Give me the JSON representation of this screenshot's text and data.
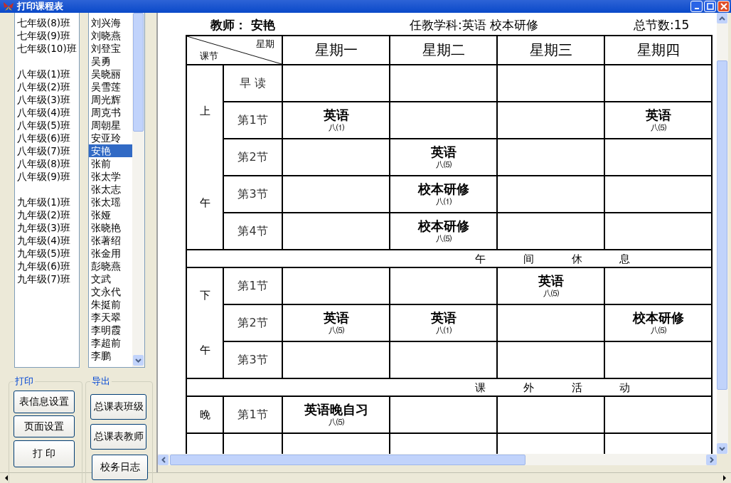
{
  "window": {
    "title": "打印课程表"
  },
  "class_groups": [
    [
      "七年级(8)班",
      "七年级(9)班",
      "七年级(10)班"
    ],
    [
      "八年级(1)班",
      "八年级(2)班",
      "八年级(3)班",
      "八年级(4)班",
      "八年级(5)班",
      "八年级(6)班",
      "八年级(7)班",
      "八年级(8)班",
      "八年级(9)班"
    ],
    [
      "九年级(1)班",
      "九年级(2)班",
      "九年级(3)班",
      "九年级(4)班",
      "九年级(5)班",
      "九年级(6)班",
      "九年级(7)班"
    ]
  ],
  "teachers": [
    {
      "name": "刘兴海",
      "selected": false
    },
    {
      "name": "刘晓燕",
      "selected": false
    },
    {
      "name": "刘登宝",
      "selected": false
    },
    {
      "name": "吴勇",
      "selected": false
    },
    {
      "name": "吴晓丽",
      "selected": false
    },
    {
      "name": "吴雪莲",
      "selected": false
    },
    {
      "name": "周光辉",
      "selected": false
    },
    {
      "name": "周克书",
      "selected": false
    },
    {
      "name": "周朝星",
      "selected": false
    },
    {
      "name": "安亚玲",
      "selected": false
    },
    {
      "name": "安艳",
      "selected": true
    },
    {
      "name": "张前",
      "selected": false
    },
    {
      "name": "张太学",
      "selected": false
    },
    {
      "name": "张太志",
      "selected": false
    },
    {
      "name": "张太瑶",
      "selected": false
    },
    {
      "name": "张娅",
      "selected": false
    },
    {
      "name": "张晓艳",
      "selected": false
    },
    {
      "name": "张著绍",
      "selected": false
    },
    {
      "name": "张金用",
      "selected": false
    },
    {
      "name": "彭晓燕",
      "selected": false
    },
    {
      "name": "文武",
      "selected": false
    },
    {
      "name": "文永代",
      "selected": false
    },
    {
      "name": "朱挺前",
      "selected": false
    },
    {
      "name": "李天翠",
      "selected": false
    },
    {
      "name": "李明霞",
      "selected": false
    },
    {
      "name": "李超前",
      "selected": false
    },
    {
      "name": "李鹏",
      "selected": false
    }
  ],
  "print_group": {
    "title": "打印",
    "buttons": [
      "表信息设置",
      "页面设置",
      "打 印"
    ]
  },
  "export_group": {
    "title": "导出",
    "buttons": [
      "总课表班级",
      "总课表教师",
      "校务日志"
    ]
  },
  "header": {
    "teacher": "教师： 安艳",
    "subjects": "任教学科:英语  校本研修",
    "total": "总节数:15"
  },
  "timetable": {
    "corner_top": "星期",
    "corner_bottom": "课节",
    "days": [
      "星期一",
      "星期二",
      "星期三",
      "星期四"
    ],
    "rows": [
      {
        "kind": "session",
        "label": [
          "上",
          "午"
        ],
        "periods": [
          {
            "label": "早 读",
            "cells": [
              null,
              null,
              null,
              null
            ]
          },
          {
            "label": "第1节",
            "cells": [
              {
                "subject": "英语",
                "class": "八⑴"
              },
              null,
              null,
              {
                "subject": "英语",
                "class": "八⑸"
              }
            ]
          },
          {
            "label": "第2节",
            "cells": [
              null,
              {
                "subject": "英语",
                "class": "八⑸"
              },
              null,
              null
            ]
          },
          {
            "label": "第3节",
            "cells": [
              null,
              {
                "subject": "校本研修",
                "class": "八⑴"
              },
              null,
              null
            ]
          },
          {
            "label": "第4节",
            "cells": [
              null,
              {
                "subject": "校本研修",
                "class": "八⑸"
              },
              null,
              null
            ]
          }
        ]
      },
      {
        "kind": "break",
        "text": "午 间 休 息"
      },
      {
        "kind": "session",
        "label": [
          "下",
          "午"
        ],
        "periods": [
          {
            "label": "第1节",
            "cells": [
              null,
              null,
              {
                "subject": "英语",
                "class": "八⑸"
              },
              null
            ]
          },
          {
            "label": "第2节",
            "cells": [
              {
                "subject": "英语",
                "class": "八⑸"
              },
              {
                "subject": "英语",
                "class": "八⑴"
              },
              null,
              {
                "subject": "校本研修",
                "class": "八⑸"
              }
            ]
          },
          {
            "label": "第3节",
            "cells": [
              null,
              null,
              null,
              null
            ]
          }
        ]
      },
      {
        "kind": "break",
        "text": "课 外 活 动"
      },
      {
        "kind": "session",
        "label": [
          "晚"
        ],
        "periods": [
          {
            "label": "第1节",
            "cells": [
              {
                "subject": "英语晚自习",
                "class": "八⑸"
              },
              null,
              null,
              null
            ]
          }
        ]
      }
    ]
  }
}
